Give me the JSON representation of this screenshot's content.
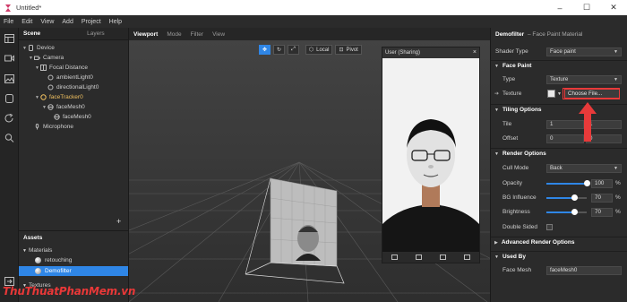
{
  "window": {
    "title": "Untitled*"
  },
  "menu": [
    "File",
    "Edit",
    "View",
    "Add",
    "Project",
    "Help"
  ],
  "scene_panel": {
    "tabs": [
      "Scene",
      "Layers"
    ],
    "tree": [
      {
        "label": "Device",
        "icon": "device-icon",
        "expanded": true
      },
      {
        "label": "Camera",
        "icon": "camera-icon",
        "expanded": true
      },
      {
        "label": "Focal Distance",
        "icon": "focal-distance-icon",
        "expanded": true
      },
      {
        "label": "ambientLight0",
        "icon": "light-icon"
      },
      {
        "label": "directionalLight0",
        "icon": "light-icon"
      },
      {
        "label": "faceTracker0",
        "icon": "face-tracker-icon",
        "expanded": true,
        "highlight": "#f0c060"
      },
      {
        "label": "faceMesh0",
        "icon": "face-mesh-icon",
        "expanded": true
      },
      {
        "label": "faceMesh0",
        "icon": "face-mesh-icon"
      },
      {
        "label": "Microphone",
        "icon": "microphone-icon"
      }
    ],
    "add_label": "+"
  },
  "assets_panel": {
    "title": "Assets",
    "items": [
      {
        "label": "Materials",
        "type": "folder"
      },
      {
        "label": "retouching",
        "type": "material"
      },
      {
        "label": "Demofilter",
        "type": "material",
        "selected": true
      },
      {
        "label": "Textures",
        "type": "folder"
      }
    ]
  },
  "viewport": {
    "tabs": [
      "Viewport",
      "Mode",
      "Filter",
      "View"
    ],
    "toolbar": {
      "local_label": "Local",
      "pivot_label": "Pivot"
    },
    "preview": {
      "device_label": "User (Sharing)",
      "close": "×"
    }
  },
  "properties": {
    "title_name": "Demofilter",
    "title_type": "– Face Paint Material",
    "shader_type": {
      "label": "Shader Type",
      "value": "Face paint"
    },
    "face_paint": {
      "title": "Face Paint",
      "type_label": "Type",
      "type_value": "Texture",
      "texture_label": "Texture",
      "choose_file": "Choose File..."
    },
    "tiling": {
      "title": "Tiling Options",
      "tile_label": "Tile",
      "tile_x": "1",
      "tile_y": "1",
      "offset_label": "Offset",
      "offset_x": "0",
      "offset_y": "0"
    },
    "render": {
      "title": "Render Options",
      "cull_label": "Cull Mode",
      "cull_value": "Back",
      "opacity_label": "Opacity",
      "opacity_value": "100",
      "opacity_pct": "%",
      "bg_label": "BG Influence",
      "bg_value": "70",
      "brightness_label": "Brightness",
      "brightness_value": "70",
      "double_label": "Double Sided"
    },
    "advanced": {
      "title": "Advanced Render Options"
    },
    "used_by": {
      "title": "Used By",
      "label": "Face Mesh",
      "value": "faceMesh0"
    },
    "sliders": {
      "opacity": 1.0,
      "bg_influence": 0.7,
      "brightness": 0.7
    }
  },
  "watermark": "ThuThuatPhanMem.vn",
  "colors": {
    "accent": "#2f86e6",
    "highlight_red": "#e83a3a",
    "tracker_yellow": "#f0c060"
  }
}
